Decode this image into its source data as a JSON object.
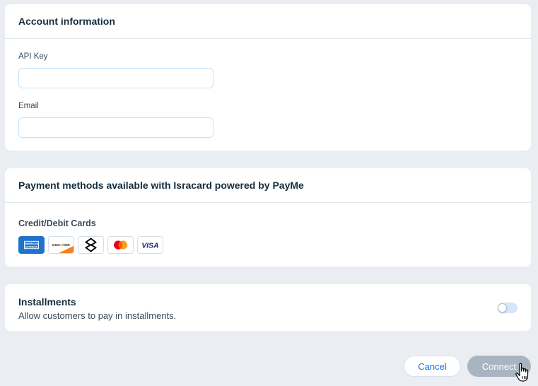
{
  "account": {
    "title": "Account information",
    "api_key_label": "API Key",
    "api_key_value": "",
    "email_label": "Email",
    "email_value": ""
  },
  "payment": {
    "title": "Payment methods available with Isracard powered by PayMe",
    "section_label": "Credit/Debit Cards",
    "methods": [
      {
        "name": "American Express",
        "icon": "amex-icon",
        "text": "AMERICAN EXPRESS",
        "color": "#1f72cd"
      },
      {
        "name": "Discover",
        "icon": "discover-icon",
        "text": "DISCOVER",
        "color": "#f48120"
      },
      {
        "name": "Isracard",
        "icon": "isracard-icon",
        "color": "#000000"
      },
      {
        "name": "Mastercard",
        "icon": "mastercard-icon",
        "colors": [
          "#eb001b",
          "#f79e1b"
        ]
      },
      {
        "name": "Visa",
        "icon": "visa-icon",
        "text": "VISA",
        "color": "#1a1f71"
      }
    ]
  },
  "installments": {
    "title": "Installments",
    "description": "Allow customers to pay in installments.",
    "enabled": false
  },
  "footer": {
    "cancel_label": "Cancel",
    "connect_label": "Connect"
  },
  "colors": {
    "accent": "#116dff",
    "disabled_button": "#a8b5c1",
    "background": "#eaedf1"
  }
}
